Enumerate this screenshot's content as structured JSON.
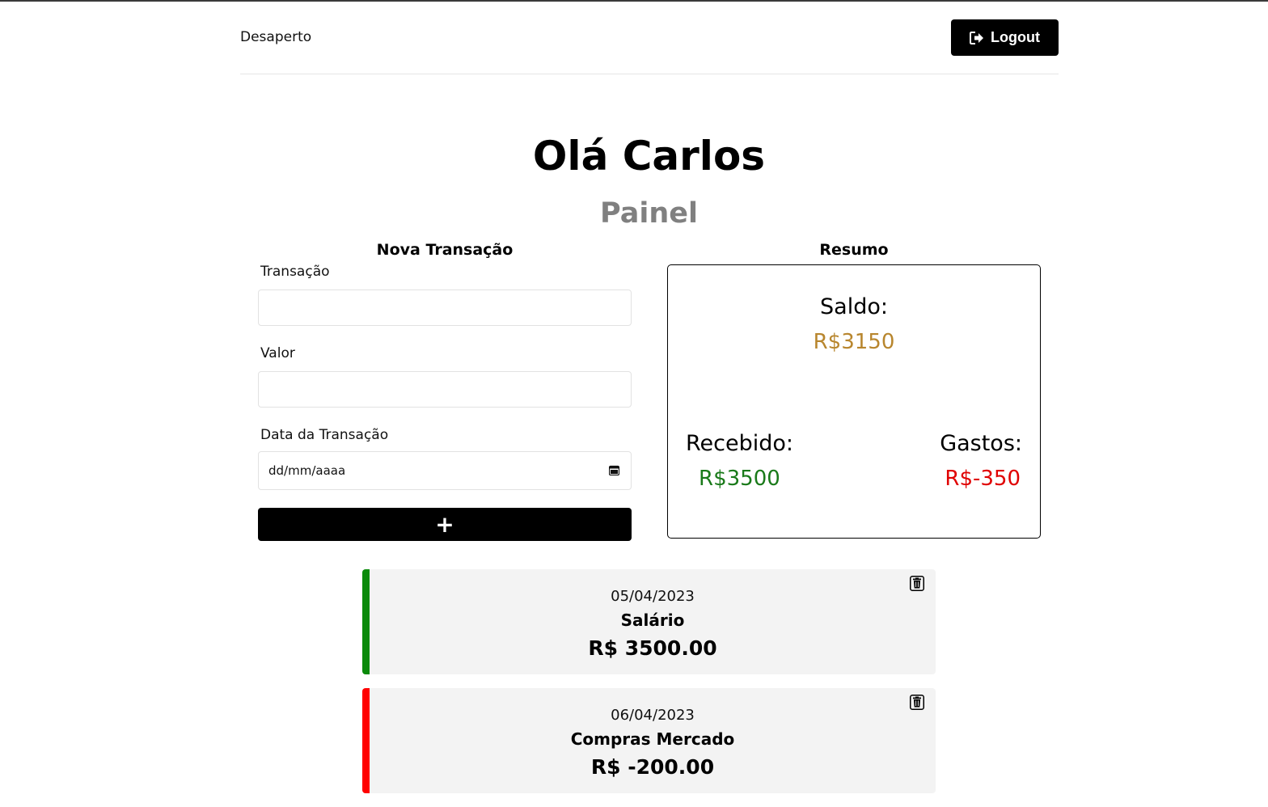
{
  "navbar": {
    "brand": "Desaperto",
    "logout_label": "Logout"
  },
  "header": {
    "greeting": "Olá Carlos",
    "subtitle": "Painel"
  },
  "form": {
    "title": "Nova Transação",
    "transacao_label": "Transação",
    "transacao_value": "",
    "valor_label": "Valor",
    "valor_value": "",
    "data_label": "Data da Transação",
    "data_placeholder": "dd/mm/aaaa",
    "add_label": "+"
  },
  "summary": {
    "title": "Resumo",
    "saldo_label": "Saldo:",
    "saldo_value": "R$3150",
    "recebido_label": "Recebido:",
    "recebido_value": "R$3500",
    "gastos_label": "Gastos:",
    "gastos_value": "R$-350"
  },
  "colors": {
    "income": "#0a8a0a",
    "expense": "#ff0000",
    "saldo": "#b8862e"
  },
  "icons": {
    "logout": "sign-out-icon",
    "calendar": "calendar-icon",
    "delete": "trash-icon"
  },
  "transactions": [
    {
      "date": "05/04/2023",
      "name": "Salário",
      "amount": "R$ 3500.00",
      "type": "income"
    },
    {
      "date": "06/04/2023",
      "name": "Compras Mercado",
      "amount": "R$ -200.00",
      "type": "expense"
    }
  ]
}
